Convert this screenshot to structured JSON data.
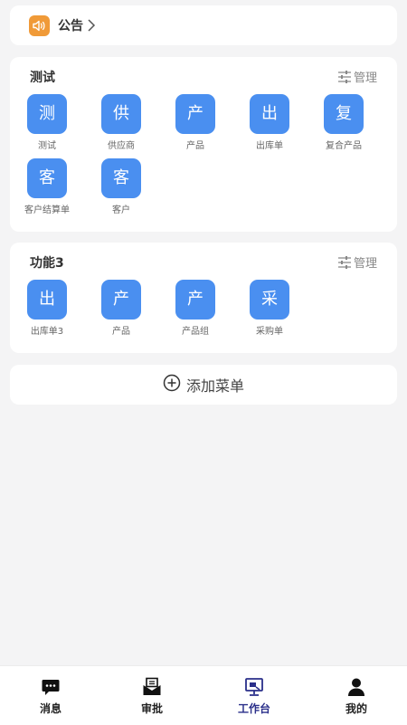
{
  "notice": {
    "label": "公告",
    "icon": "speaker-icon"
  },
  "sections": [
    {
      "title": "测试",
      "manage_label": "管理",
      "items": [
        {
          "char": "测",
          "label": "测试"
        },
        {
          "char": "供",
          "label": "供应商"
        },
        {
          "char": "产",
          "label": "产品"
        },
        {
          "char": "出",
          "label": "出库单"
        },
        {
          "char": "复",
          "label": "复合产品"
        },
        {
          "char": "客",
          "label": "客户结算单"
        },
        {
          "char": "客",
          "label": "客户"
        }
      ]
    },
    {
      "title": "功能3",
      "manage_label": "管理",
      "items": [
        {
          "char": "出",
          "label": "出库单3"
        },
        {
          "char": "产",
          "label": "产品"
        },
        {
          "char": "产",
          "label": "产品组"
        },
        {
          "char": "采",
          "label": "采购单"
        }
      ]
    }
  ],
  "add_menu": {
    "label": "添加菜单"
  },
  "tabbar": {
    "tabs": [
      {
        "label": "消息",
        "icon": "chat-bubble-icon",
        "active": false
      },
      {
        "label": "审批",
        "icon": "approval-envelope-icon",
        "active": false
      },
      {
        "label": "工作台",
        "icon": "workbench-monitor-icon",
        "active": true
      },
      {
        "label": "我的",
        "icon": "user-icon",
        "active": false
      }
    ]
  },
  "colors": {
    "accent": "#4a8ff0",
    "notice": "#f09a38",
    "active_tab": "#2a2f8a",
    "background": "#f4f4f5"
  }
}
